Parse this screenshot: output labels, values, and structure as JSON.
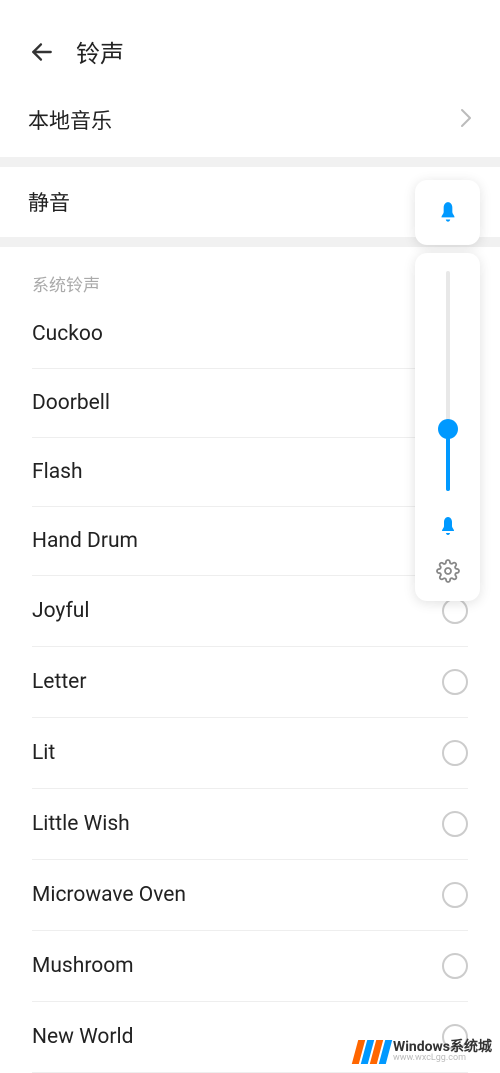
{
  "header": {
    "title": "铃声"
  },
  "local_music": {
    "label": "本地音乐"
  },
  "silent": {
    "label": "静音"
  },
  "system_section": {
    "title": "系统铃声"
  },
  "ringtones": [
    {
      "name": "Cuckoo"
    },
    {
      "name": "Doorbell"
    },
    {
      "name": "Flash"
    },
    {
      "name": "Hand Drum"
    },
    {
      "name": "Joyful"
    },
    {
      "name": "Letter"
    },
    {
      "name": "Lit"
    },
    {
      "name": "Little Wish"
    },
    {
      "name": "Microwave Oven"
    },
    {
      "name": "Mushroom"
    },
    {
      "name": "New World"
    }
  ],
  "volume": {
    "percent": 28
  },
  "colors": {
    "accent": "#0099ff"
  },
  "watermark": {
    "title": "Windows系统城",
    "sub": "www.wxcLgg.com"
  }
}
